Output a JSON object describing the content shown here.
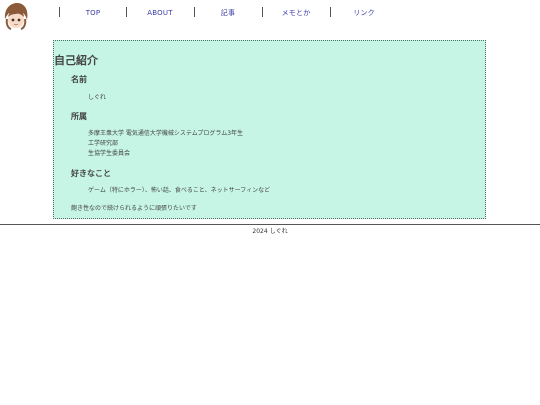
{
  "nav": {
    "items": [
      {
        "label": "TOP"
      },
      {
        "label": "ABOUT"
      },
      {
        "label": "記事"
      },
      {
        "label": "メモとか"
      },
      {
        "label": "リンク"
      }
    ]
  },
  "profile": {
    "title": "自己紹介",
    "name_heading": "名前",
    "name_value": "しぐれ",
    "affiliation_heading": "所属",
    "affiliation_lines": [
      "多摩王衆大学 電気通信大学機械システムプログラム3年生",
      "工学研究部",
      "生協学生委員会"
    ],
    "likes_heading": "好きなこと",
    "likes_value": "ゲーム（特にホラー）、怖い話、食べること、ネットサーフィンなど",
    "closing_note": "飽き性なので続けられるように頑張りたいです"
  },
  "footer": {
    "text": "2024 しぐれ"
  },
  "colors": {
    "card_bg": "#c6f5e6",
    "nav_link": "#3a3aa8"
  },
  "icons": {
    "avatar": "avatar-illustration"
  }
}
